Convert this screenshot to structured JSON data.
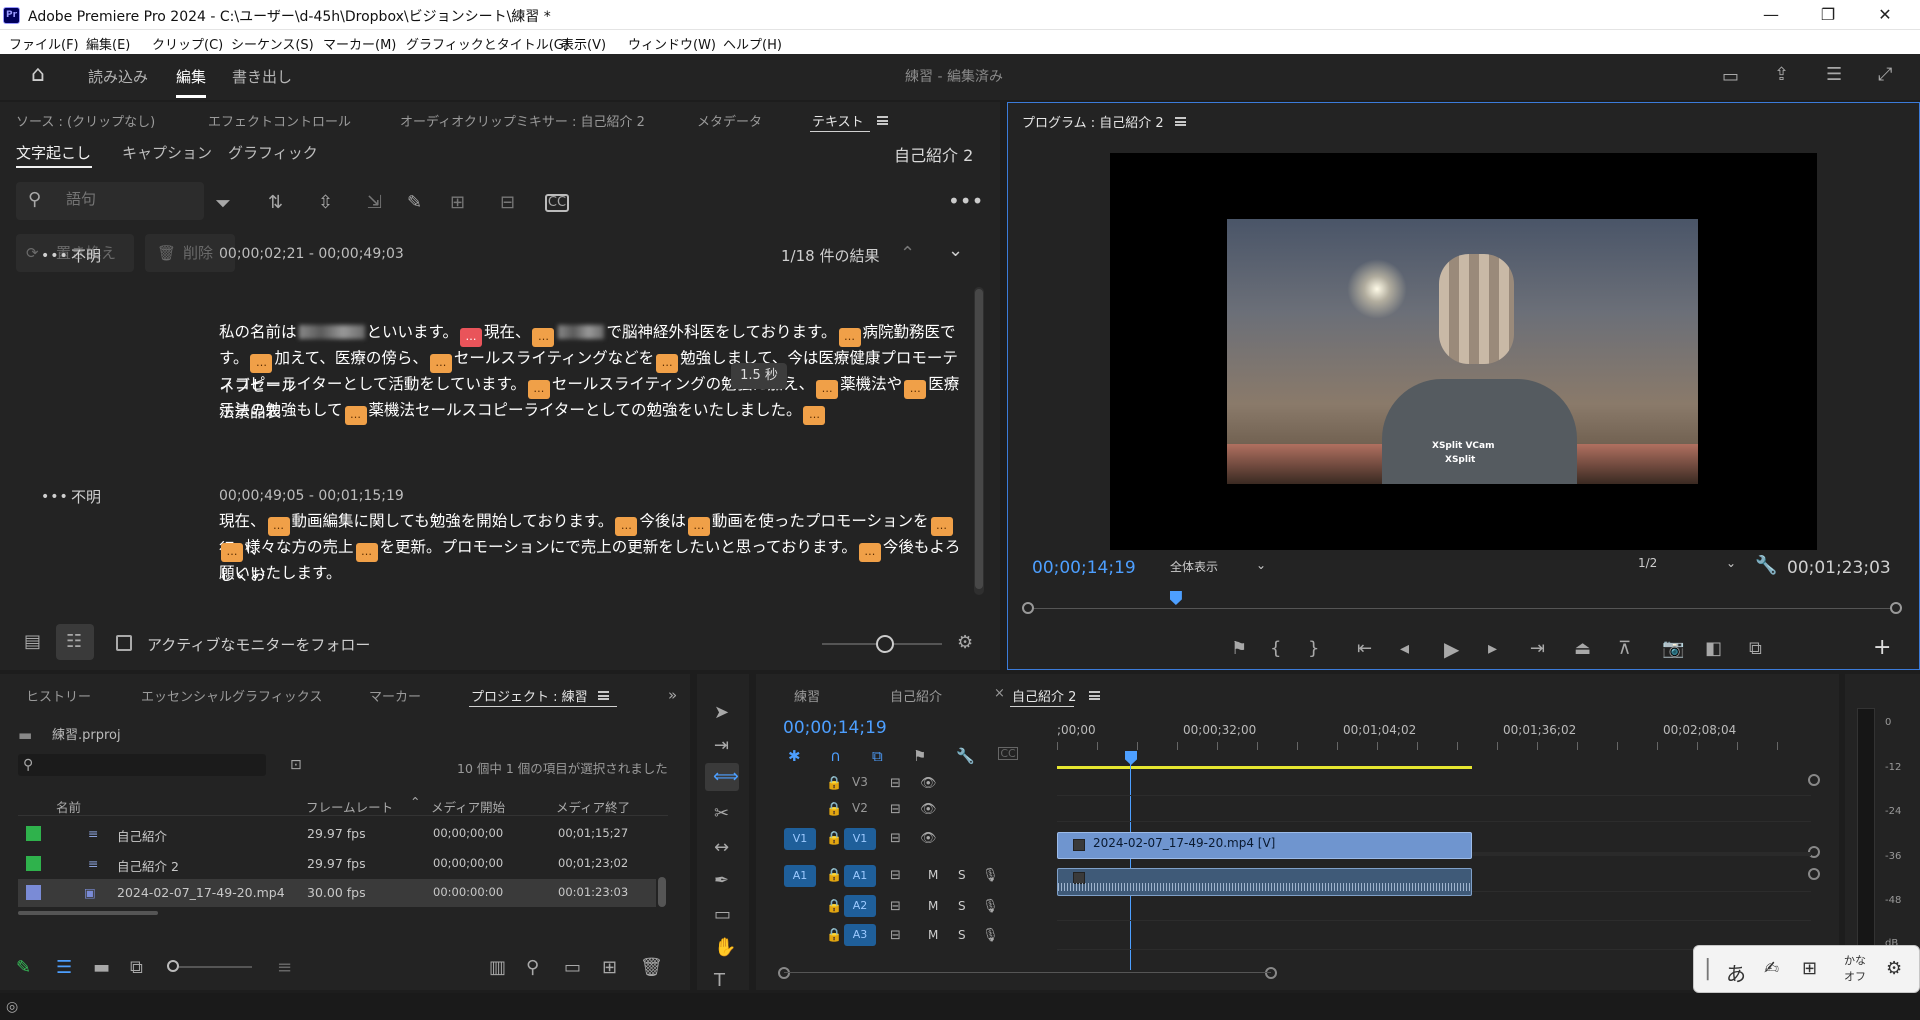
{
  "window": {
    "title": "Adobe Premiere Pro 2024 - C:\\ユーザー\\d-45h\\Dropbox\\ビジョンシート\\練習 *",
    "app_icon": "Pr",
    "minimize": "—",
    "restore": "❐",
    "close": "✕"
  },
  "menu": [
    "ファイル(F)",
    "編集(E)",
    "クリップ(C)",
    "シーケンス(S)",
    "マーカー(M)",
    "グラフィックとタイトル(G)",
    "表示(V)",
    "ウィンドウ(W)",
    "ヘルプ(H)"
  ],
  "workspace": {
    "tabs": [
      "読み込み",
      "編集",
      "書き出し"
    ],
    "active_tab": "編集",
    "project_status": "練習 - 編集済み"
  },
  "source_panel": {
    "tabs": [
      "ソース : (クリップなし)",
      "エフェクトコントロール",
      "オーディオクリップミキサー : 自己紹介 2",
      "メタデータ",
      "テキスト"
    ],
    "active_tab": "テキスト",
    "subtabs": [
      "文字起こし",
      "キャプション",
      "グラフィック"
    ],
    "active_subtab": "文字起こし",
    "sequence_name": "自己紹介 2",
    "search_placeholder": "語句",
    "replace_label": "置き換え",
    "delete_label": "削除",
    "results": "1/18 件の結果",
    "follow_monitor_label": "アクティブなモニターをフォロー",
    "tooltip": "1.5 秒",
    "blocks": [
      {
        "speaker": "不明",
        "time": "00;00;02;21 - 00;00;49;03",
        "line1_a": "私の名前は",
        "line1_b": "といいます。",
        "line1_c": "現在、",
        "line1_d": "で脳神経外科医をしております。",
        "line1_e": "病院勤務医で",
        "line2_a": "す。",
        "line2_b": "加えて、医療の傍ら、",
        "line2_c": "セールスライティングなどを",
        "line2_d": "勉強しまして、今は医療健康プロモーティブセール",
        "line3_a": "スコピーライターとして活動をしています。",
        "line3_b": "セールスライティングの勉強に加え、",
        "line3_c": "薬機法や",
        "line3_d": "医療法景品表",
        "line4_a": "示法の勉強もして",
        "line4_b": "薬機法セールスコピーライターとしての勉強をいたしました。"
      },
      {
        "speaker": "不明",
        "time": "00;00;49;05 - 00;01;15;19",
        "line1_a": "現在、",
        "line1_b": "動画編集に関しても勉強を開始しております。",
        "line1_c": "今後は",
        "line1_d": "動画を使ったプロモーションを",
        "line1_e": "行い、",
        "line2_a": "様々な方の売上",
        "line2_b": "を更新。プロモーションにで売上の更新をしたいと思っております。",
        "line2_c": "今後もよろしくお",
        "line3_a": "願いいたします。"
      }
    ]
  },
  "program_monitor": {
    "title": "プログラム : 自己紹介 2",
    "timecode": "00;00;14;19",
    "fit": "全体表示",
    "resolution": "1/2",
    "duration": "00;01;23;03",
    "watermark1": "XSplit VCam",
    "watermark2": "XSplit",
    "playhead_fraction": 0.17
  },
  "project_panel": {
    "tabs": [
      "ヒストリー",
      "エッセンシャルグラフィックス",
      "マーカー",
      "プロジェクト : 練習"
    ],
    "active_tab": "プロジェクト : 練習",
    "file": "練習.prproj",
    "selection_status": "10 個中 1 個の項目が選択されました",
    "columns": [
      "名前",
      "フレームレート",
      "メディア開始",
      "メディア終了"
    ],
    "rows": [
      {
        "name": "自己紹介",
        "fps": "29.97 fps",
        "start": "00;00;00;00",
        "end": "00;01;15;27",
        "color": "#2fb24c"
      },
      {
        "name": "自己紹介 2",
        "fps": "29.97 fps",
        "start": "00;00;00;00",
        "end": "00;01;23;02",
        "color": "#2fb24c"
      },
      {
        "name": "2024-02-07_17-49-20.mp4",
        "fps": "30.00 fps",
        "start": "00:00:00:00",
        "end": "00:01:23:03",
        "color": "#7a8bd6"
      }
    ]
  },
  "timeline": {
    "tabs": [
      "練習",
      "自己紹介",
      "自己紹介 2"
    ],
    "active_tab": "自己紹介 2",
    "timecode": "00;00;14;19",
    "ruler": [
      ";00;00",
      "00;00;32;00",
      "00;01;04;02",
      "00;01;36;02",
      "00;02;08;04"
    ],
    "video_tracks": [
      "V3",
      "V2",
      "V1"
    ],
    "audio_tracks": [
      "A1",
      "A2",
      "A3"
    ],
    "source_v": "V1",
    "source_a": "A1",
    "clip_label": "2024-02-07_17-49-20.mp4 [V]",
    "m_label": "M",
    "s_label": "S"
  },
  "meter": {
    "labels": [
      "0",
      "-12",
      "-24",
      "-36",
      "-48",
      "dB"
    ]
  },
  "ime": {
    "mode": "あ",
    "kana": "かな",
    "off": "オフ"
  },
  "colors": {
    "accent_blue": "#4d9fff",
    "pause_orange": "#f0a048",
    "pause_red": "#e9545a",
    "video_clip": "#6f95cf",
    "audio_clip": "#3f5a78",
    "work_area": "#e6e630"
  }
}
